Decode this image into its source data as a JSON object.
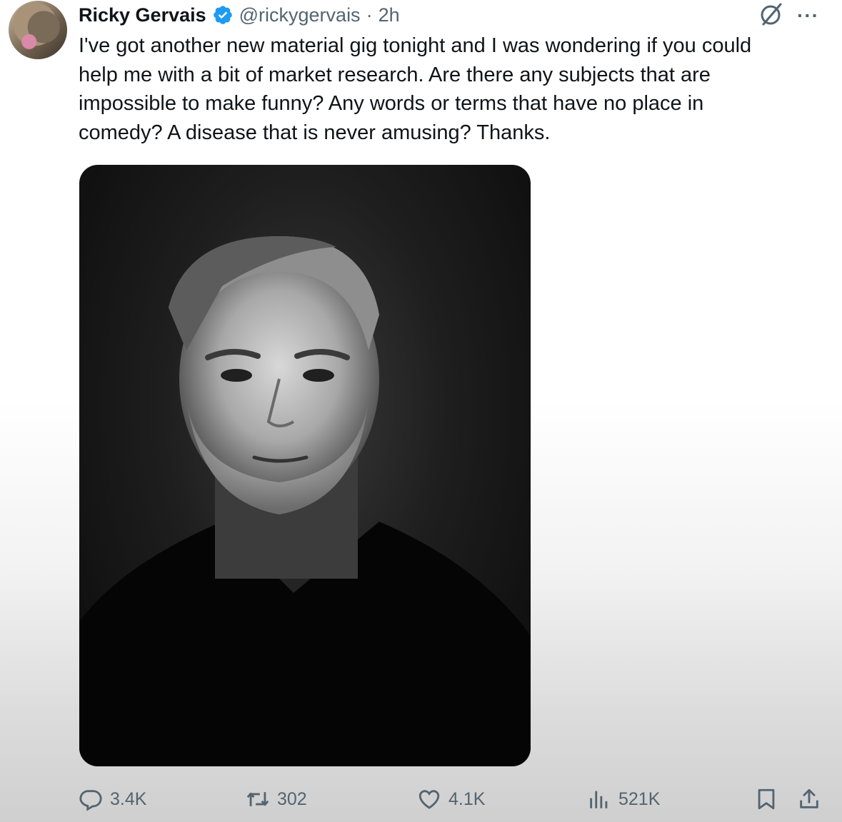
{
  "tweet": {
    "author_name": "Ricky Gervais",
    "handle": "@rickygervais",
    "separator": "·",
    "time": "2h",
    "text": "I've got another new material gig tonight and I was wondering if you could\nhelp me with a bit of market research. Are there any subjects that are\nimpossible to make funny? Any words or terms that have no place in\ncomedy? A disease that is never amusing? Thanks."
  },
  "icons": {
    "verified": "verified-badge-icon",
    "grok": "grok-icon",
    "more": "more-icon",
    "reply": "reply-icon",
    "repost": "repost-icon",
    "like": "heart-icon",
    "views": "views-icon",
    "bookmark": "bookmark-icon",
    "share": "share-icon"
  },
  "actions": {
    "replies": "3.4K",
    "reposts": "302",
    "likes": "4.1K",
    "views": "521K"
  },
  "colors": {
    "verified": "#1d9bf0",
    "text": "#0f1419",
    "secondary": "#536471"
  }
}
